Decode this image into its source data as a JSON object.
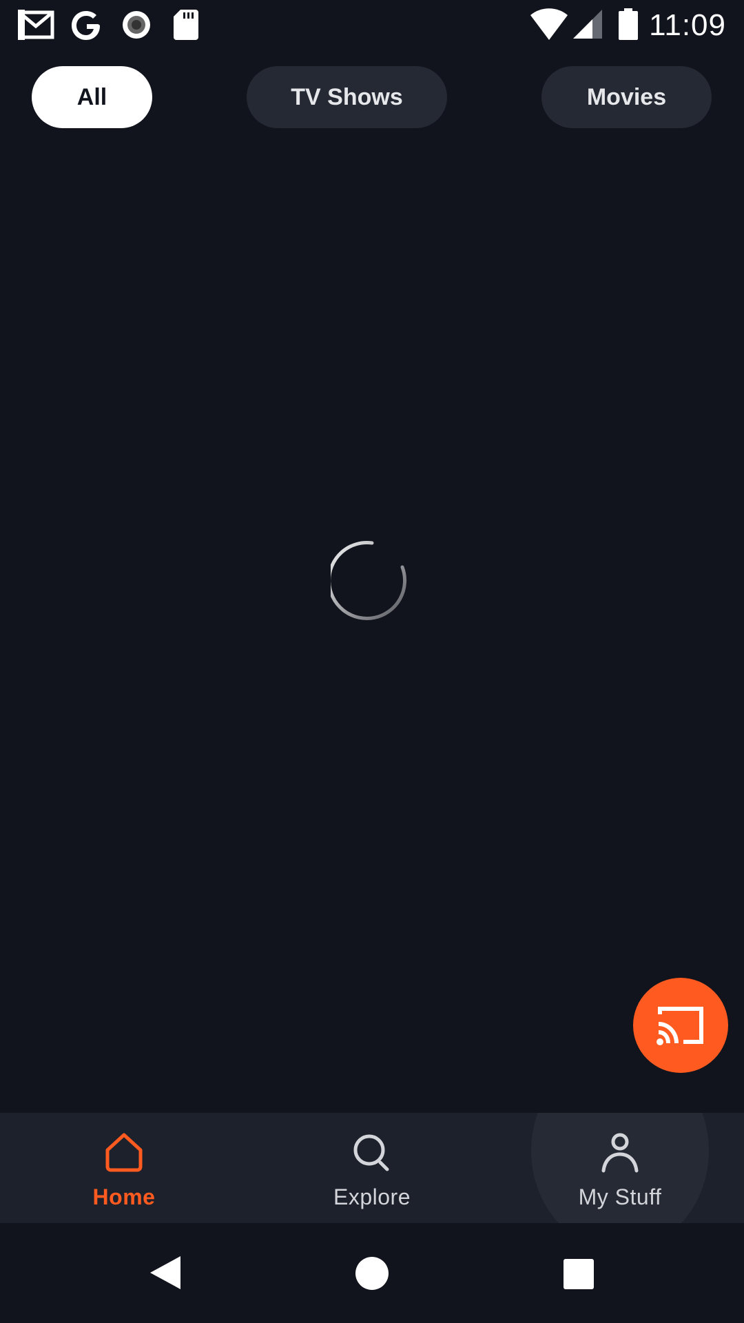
{
  "status_bar": {
    "time": "11:09",
    "icons": [
      "gmail-icon",
      "google-icon",
      "record-icon",
      "sd-card-icon",
      "wifi-icon",
      "cell-signal-icon",
      "battery-icon"
    ]
  },
  "filters": {
    "tabs": [
      {
        "label": "All",
        "selected": true
      },
      {
        "label": "TV Shows",
        "selected": false
      },
      {
        "label": "Movies",
        "selected": false
      }
    ]
  },
  "loading": {
    "icon": "loading-spinner"
  },
  "cast_button": {
    "icon": "cast-icon"
  },
  "bottom_nav": {
    "items": [
      {
        "label": "Home",
        "icon": "home-icon",
        "selected": true
      },
      {
        "label": "Explore",
        "icon": "search-icon",
        "selected": false
      },
      {
        "label": "My Stuff",
        "icon": "profile-icon",
        "selected": false
      }
    ]
  },
  "system_nav": {
    "icons": [
      "back-icon",
      "home-circle-icon",
      "recents-icon"
    ]
  },
  "colors": {
    "background": "#11141d",
    "accent": "#ff5a1f",
    "chip_inactive": "#252933",
    "nav_background": "#1d212b"
  }
}
